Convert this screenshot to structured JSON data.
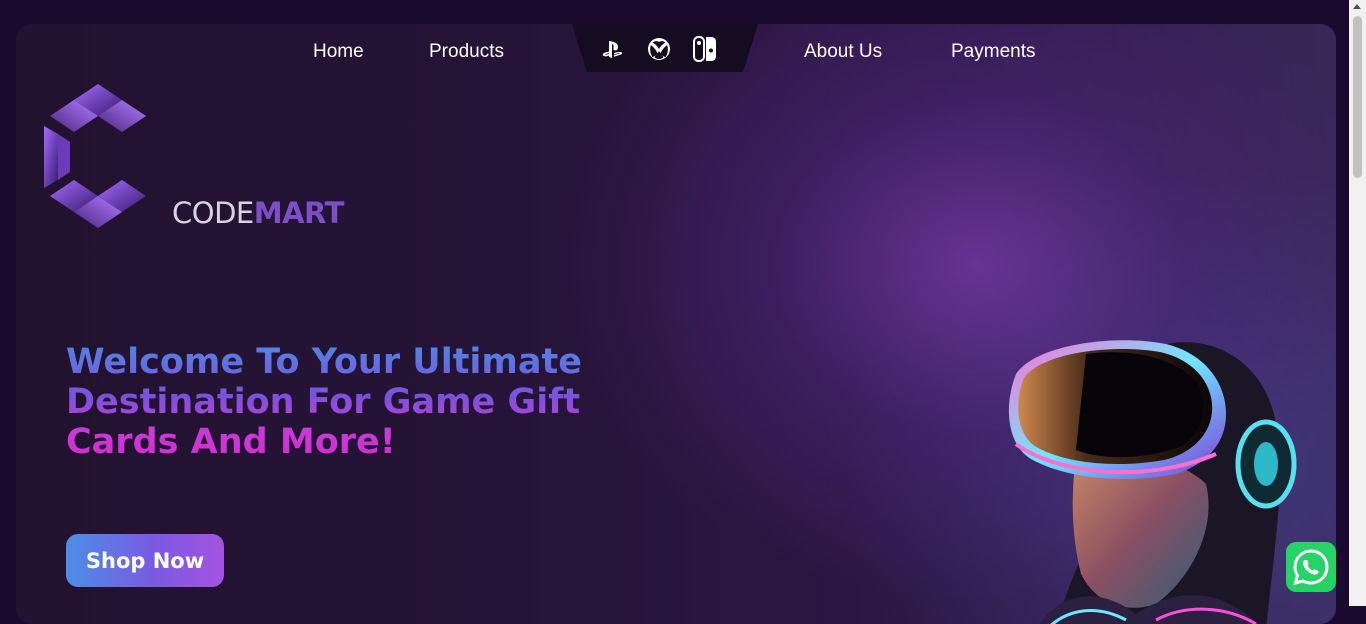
{
  "nav": {
    "home": "Home",
    "products": "Products",
    "about": "About Us",
    "payments": "Payments",
    "console_icons": [
      "playstation-icon",
      "xbox-icon",
      "nintendo-switch-icon"
    ]
  },
  "logo": {
    "code": "CODE",
    "mart": "MART"
  },
  "hero": {
    "line1": "Welcome To Your Ultimate",
    "line2": "Destination For Game Gift",
    "line3": "Cards And More!",
    "cta": "Shop Now"
  },
  "colors": {
    "page_bg": "#1a0a2e",
    "brand_purple": "#7d4fc4",
    "cta_start": "#4c8ee6",
    "cta_end": "#a453e0",
    "whatsapp": "#25d366"
  },
  "floating": {
    "icon": "whatsapp-icon"
  }
}
